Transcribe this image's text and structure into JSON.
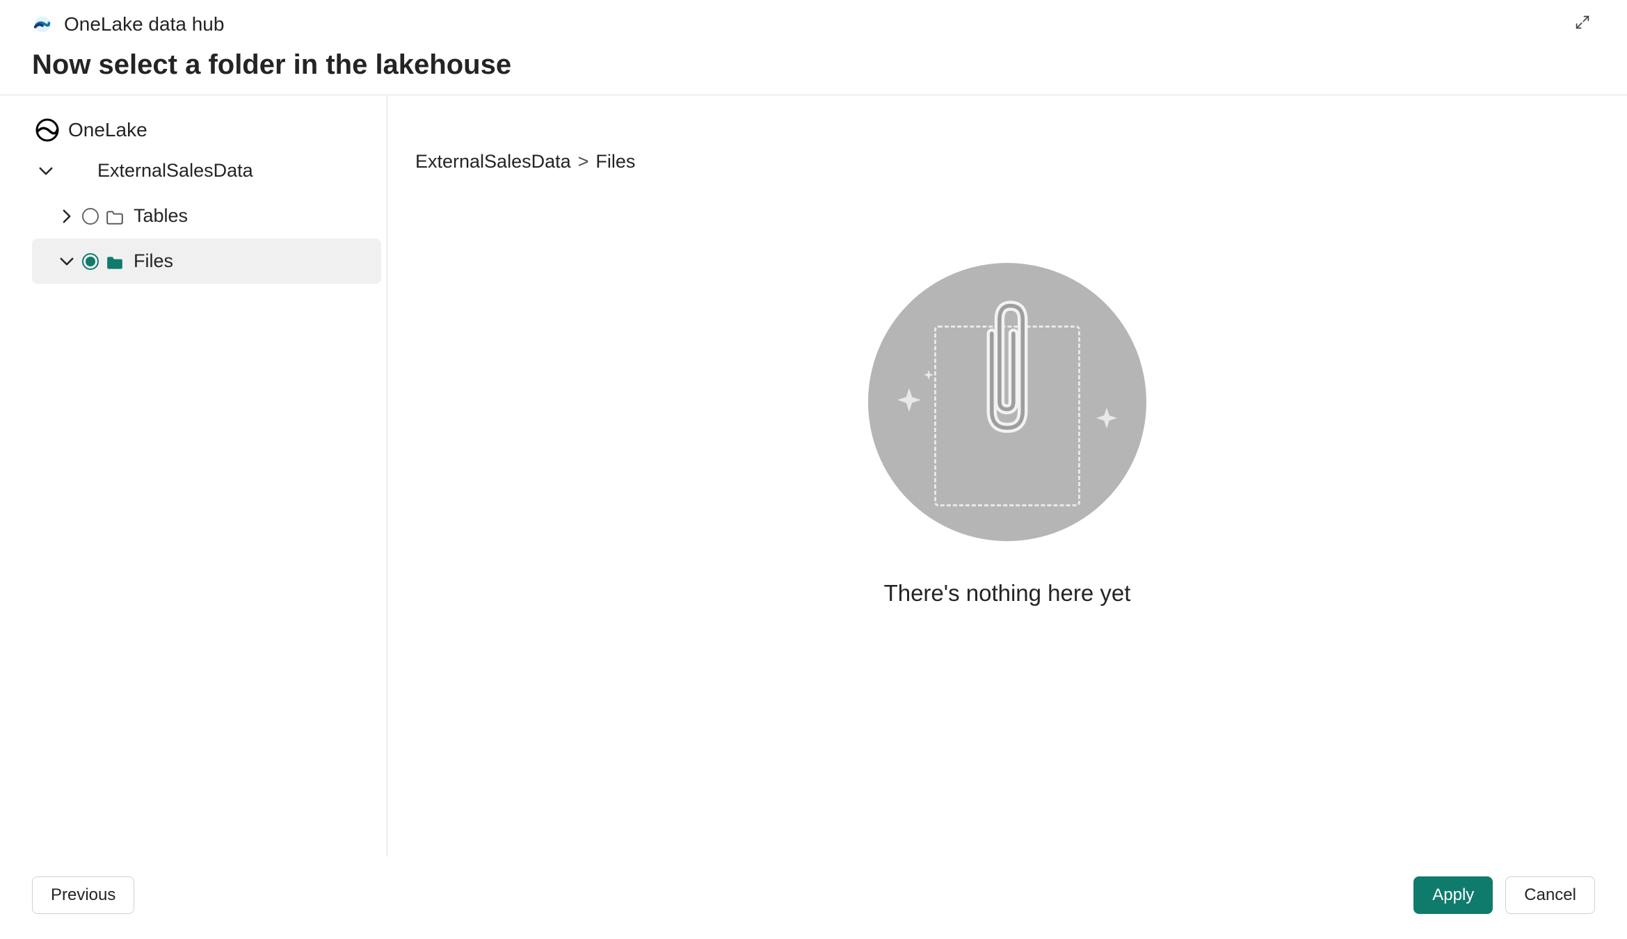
{
  "header": {
    "hub_title": "OneLake data hub",
    "page_title": "Now select a folder in the lakehouse",
    "expand_icon": "expand-diagonal-icon"
  },
  "sidebar": {
    "root_label": "OneLake",
    "tree": {
      "lakehouse_label": "ExternalSalesData",
      "nodes": [
        {
          "label": "Tables",
          "selected": false,
          "expanded": false
        },
        {
          "label": "Files",
          "selected": true,
          "expanded": true
        }
      ]
    }
  },
  "breadcrumb": {
    "segments": [
      "ExternalSalesData",
      "Files"
    ],
    "separator": ">"
  },
  "empty_state": {
    "message": "There's nothing here yet"
  },
  "footer": {
    "previous_label": "Previous",
    "apply_label": "Apply",
    "cancel_label": "Cancel"
  },
  "colors": {
    "accent": "#0f7b6c",
    "muted_circle": "#b5b5b5"
  }
}
